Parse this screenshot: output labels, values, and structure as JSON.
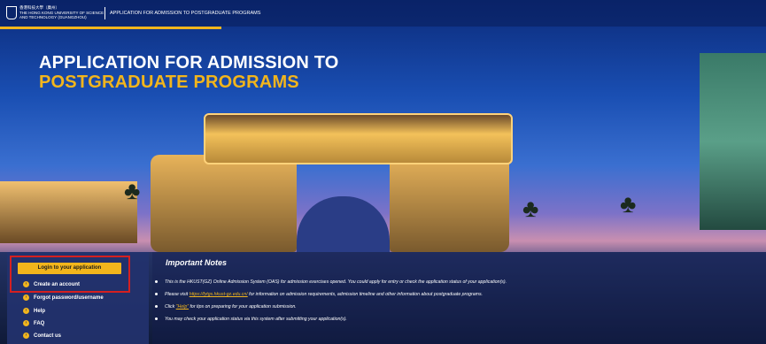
{
  "header": {
    "uni_line1": "香港科技大學（廣州）",
    "uni_line2": "THE HONG KONG UNIVERSITY OF SCIENCE",
    "uni_line3": "AND TECHNOLOGY (GUANGZHOU)",
    "app_title": "APPLICATION FOR ADMISSION TO POSTGRADUATE PROGRAMS"
  },
  "hero": {
    "title_line1": "APPLICATION FOR ADMISSION TO",
    "title_line2": "POSTGRADUATE PROGRAMS"
  },
  "sidebar": {
    "login_label": "Login to your application",
    "items": [
      {
        "label": "Create an account"
      },
      {
        "label": "Forgot password/username"
      },
      {
        "label": "Help"
      },
      {
        "label": "FAQ"
      },
      {
        "label": "Contact us"
      }
    ]
  },
  "notes": {
    "title": "Important Notes",
    "n1": "This is the HKUST(GZ) Online Admission System (OAS) for admission exercises opened. You could apply for entry or check the application status of your application(s).",
    "n2_pre": "Please visit ",
    "n2_link": "https://fytgs.hkust-gz.edu.cn/",
    "n2_post": " for information on admission requirements, admission timeline and other information about postgraduate programs.",
    "n3_pre": "Click ",
    "n3_link": "\"Help\"",
    "n3_post": " for tips on preparing for your application submission.",
    "n4": "You may check your application status via this system after submitting your application(s)."
  },
  "colors": {
    "accent": "#f2b51c",
    "highlight": "#d52020"
  }
}
